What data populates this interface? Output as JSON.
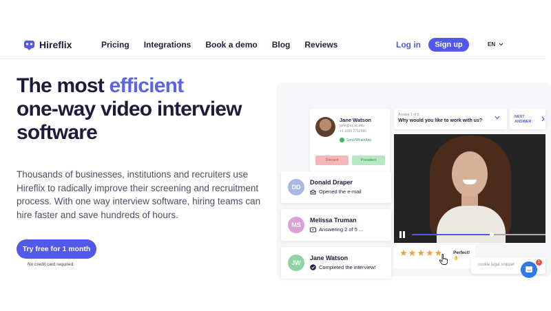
{
  "brand": {
    "name": "Hireflix",
    "accent": "#5258ea"
  },
  "nav": {
    "links": [
      "Pricing",
      "Integrations",
      "Book a demo",
      "Blog",
      "Reviews"
    ],
    "login": "Log in",
    "signup": "Sign up",
    "language": "EN"
  },
  "hero": {
    "title_prefix": "The most ",
    "title_accent": "efficient",
    "title_line2": "one-way video interview",
    "title_line3": "software",
    "description": "Thousands of businesses, institutions and recruiters use Hireflix to radically improve their screening and recruitment process. With one way interview software, hiring teams can hire faster and save hundreds of hours.",
    "cta": "Try free for 1 month",
    "cta_note": "No credit card required"
  },
  "profile": {
    "name": "Jane Watson",
    "email": "jane@ox.ac.edu",
    "phone": "+1 1665 2712996",
    "whatsapp": "Send WhatsApp",
    "discard": "Discard",
    "preselect": "Preselect"
  },
  "question": {
    "count": "Answer 1 of 5",
    "text": "Why would you like to work with us?",
    "next": "NEXT ANSWER"
  },
  "video": {
    "progress": 0.6
  },
  "rating": {
    "stars": 5,
    "filled": 5,
    "text": "Perfect! 👌",
    "star_color": "#f2a23a"
  },
  "candidates": [
    {
      "initials": "DD",
      "name": "Donald Draper",
      "status": "Opened the e-mail",
      "icon": "envelope-icon",
      "color": "#a9b8e0"
    },
    {
      "initials": "MS",
      "name": "Melissa Truman",
      "status": "Answering 2 of 5 ...",
      "icon": "video-icon",
      "color": "#d9a2d6"
    },
    {
      "initials": "JW",
      "name": "Jane Watson",
      "status": "Completed the interview!",
      "icon": "check-circle-icon",
      "color": "#8fd3a4"
    }
  ],
  "cookie": {
    "text": "cookie legal snippet"
  },
  "chat": {
    "badge": "1"
  }
}
